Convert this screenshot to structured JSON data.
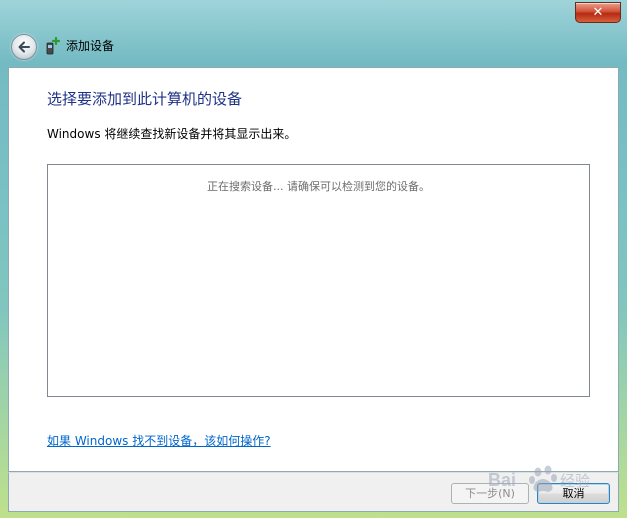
{
  "window": {
    "title": "添加设备",
    "close_glyph": "✕"
  },
  "page": {
    "heading": "选择要添加到此计算机的设备",
    "description": "Windows 将继续查找新设备并将其显示出来。",
    "searching_status": "正在搜索设备...  请确保可以检测到您的设备。",
    "help_link": "如果 Windows 找不到设备，该如何操作?"
  },
  "footer": {
    "next_label": "下一步(N)",
    "cancel_label": "取消"
  },
  "watermark": {
    "text": "Bai 经验"
  },
  "icons": {
    "back": "back-arrow-icon",
    "title": "add-device-icon",
    "close": "close-icon"
  },
  "colors": {
    "heading": "#1e3287",
    "link": "#0066cc",
    "close_button": "#d2523a"
  }
}
